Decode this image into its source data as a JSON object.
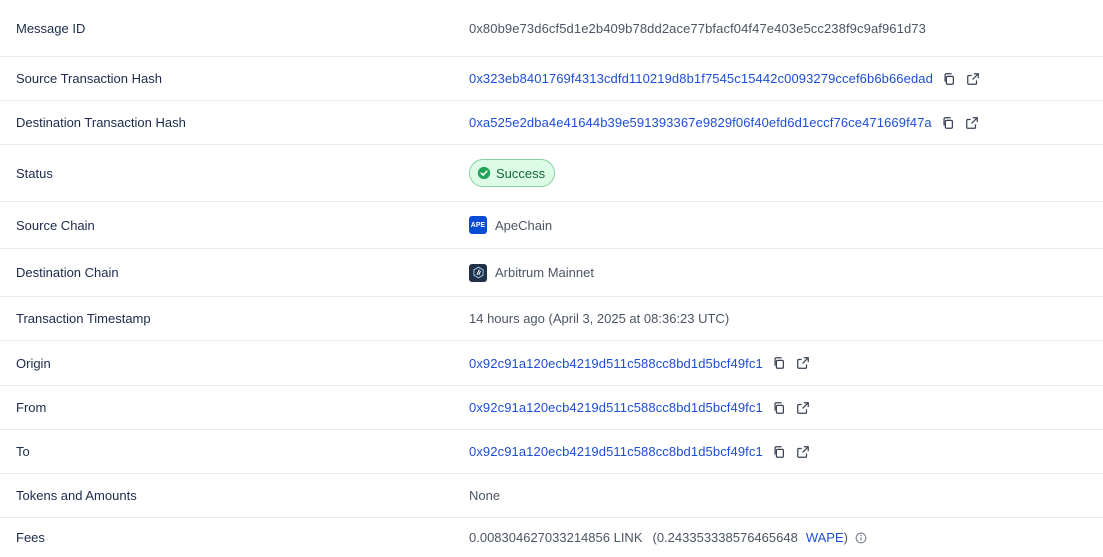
{
  "rows": {
    "message_id": {
      "label": "Message ID",
      "value": "0x80b9e73d6cf5d1e2b409b78dd2ace77bfacf04f47e403e5cc238f9c9af961d73"
    },
    "source_tx": {
      "label": "Source Transaction Hash",
      "value": "0x323eb8401769f4313cdfd110219d8b1f7545c15442c0093279ccef6b6b66edad"
    },
    "dest_tx": {
      "label": "Destination Transaction Hash",
      "value": "0xa525e2dba4e41644b39e591393367e9829f06f40efd6d1eccf76ce471669f47a"
    },
    "status": {
      "label": "Status",
      "value": "Success"
    },
    "source_chain": {
      "label": "Source Chain",
      "value": "ApeChain",
      "logo_text": "APE"
    },
    "dest_chain": {
      "label": "Destination Chain",
      "value": "Arbitrum Mainnet"
    },
    "timestamp": {
      "label": "Transaction Timestamp",
      "value": "14 hours ago (April 3, 2025 at 08:36:23 UTC)"
    },
    "origin": {
      "label": "Origin",
      "value": "0x92c91a120ecb4219d511c588cc8bd1d5bcf49fc1"
    },
    "from": {
      "label": "From",
      "value": "0x92c91a120ecb4219d511c588cc8bd1d5bcf49fc1"
    },
    "to": {
      "label": "To",
      "value": "0x92c91a120ecb4219d511c588cc8bd1d5bcf49fc1"
    },
    "tokens": {
      "label": "Tokens and Amounts",
      "value": "None"
    },
    "fees": {
      "label": "Fees",
      "value": "0.008304627033214856 LINK",
      "paren_open": "(0.243353338576465648",
      "token": "WAPE",
      "paren_close": ")"
    }
  },
  "colors": {
    "link": "#1d4ed8",
    "success_bg": "#dcfce7",
    "success_border": "#86d3a0",
    "ape_blue": "#0a4bd6",
    "arbitrum_dark": "#213147"
  },
  "icons": [
    "copy-icon",
    "external-link-icon",
    "check-circle-icon",
    "info-icon"
  ]
}
